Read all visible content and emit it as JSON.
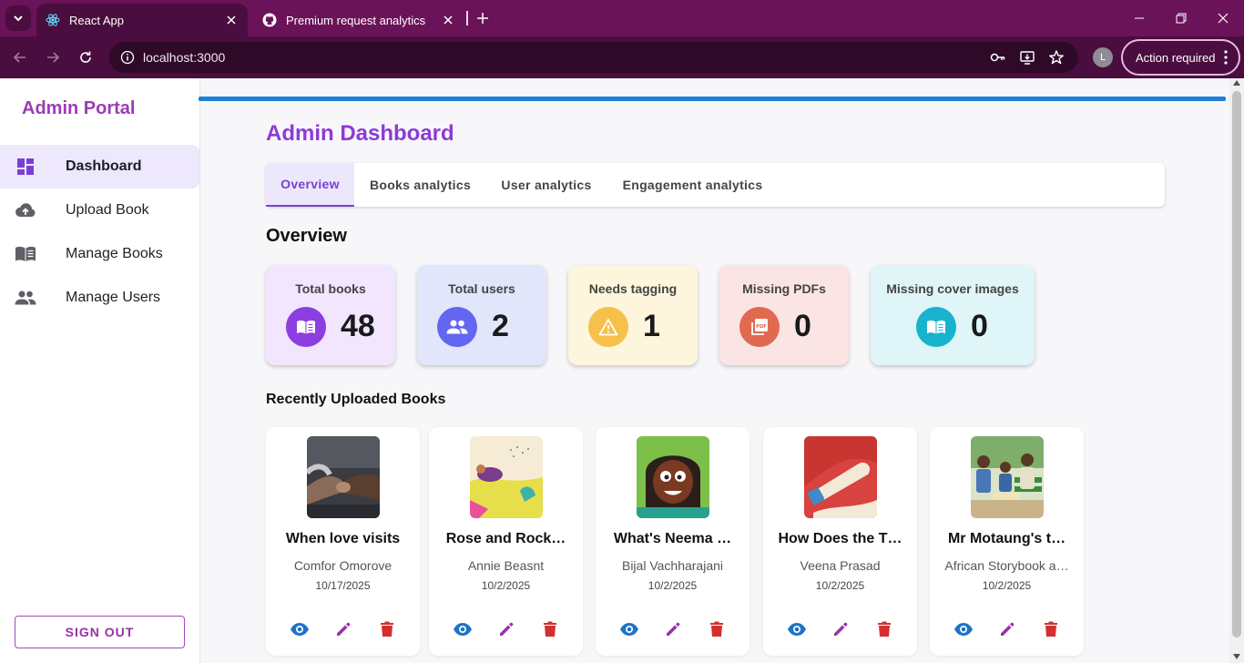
{
  "browser": {
    "tabs": [
      {
        "title": "React App",
        "icon": "react-icon"
      },
      {
        "title": "Premium request analytics",
        "icon": "github-icon"
      }
    ],
    "url": "localhost:3000",
    "profile_initial": "L",
    "action_required": "Action required"
  },
  "sidebar": {
    "brand": "Admin Portal",
    "items": [
      {
        "label": "Dashboard",
        "icon": "dashboard-icon"
      },
      {
        "label": "Upload Book",
        "icon": "cloud-upload-icon"
      },
      {
        "label": "Manage Books",
        "icon": "book-icon"
      },
      {
        "label": "Manage Users",
        "icon": "people-icon"
      }
    ],
    "sign_out": "SIGN OUT"
  },
  "main": {
    "title": "Admin Dashboard",
    "tabs": [
      "Overview",
      "Books analytics",
      "User analytics",
      "Engagement analytics"
    ],
    "overview_title": "Overview",
    "stats": [
      {
        "label": "Total books",
        "value": "48",
        "icon": "book-open-icon",
        "bg": "#f1e6fd",
        "icon_bg": "#8b3fe0"
      },
      {
        "label": "Total users",
        "value": "2",
        "icon": "people-icon",
        "bg": "#e2e6fb",
        "icon_bg": "#6366f1"
      },
      {
        "label": "Needs tagging",
        "value": "1",
        "icon": "warning-icon",
        "bg": "#fdf6dd",
        "icon_bg": "#f6c04a"
      },
      {
        "label": "Missing PDFs",
        "value": "0",
        "icon": "pdf-icon",
        "bg": "#fbe5e4",
        "icon_bg": "#e06a4f"
      },
      {
        "label": "Missing cover images",
        "value": "0",
        "icon": "book-open-icon",
        "bg": "#dff5f7",
        "icon_bg": "#17b3ce"
      }
    ],
    "recent_title": "Recently Uploaded Books",
    "books": [
      {
        "title": "When love visits",
        "author": "Comfor Omorove",
        "date": "10/17/2025"
      },
      {
        "title": "Rose and Rock…",
        "author": "Annie Beasnt",
        "date": "10/2/2025"
      },
      {
        "title": "What's Neema …",
        "author": "Bijal Vachharajani",
        "date": "10/2/2025"
      },
      {
        "title": "How Does the T…",
        "author": "Veena Prasad",
        "date": "10/2/2025"
      },
      {
        "title": "Mr Motaung's t…",
        "author": "African Storybook a…",
        "date": "10/2/2025"
      }
    ]
  },
  "colors": {
    "accent": "#8e3ad6",
    "view": "#1e73c8",
    "edit": "#9c2fae",
    "delete": "#d32f2f",
    "progress": "#1e7fd6"
  }
}
